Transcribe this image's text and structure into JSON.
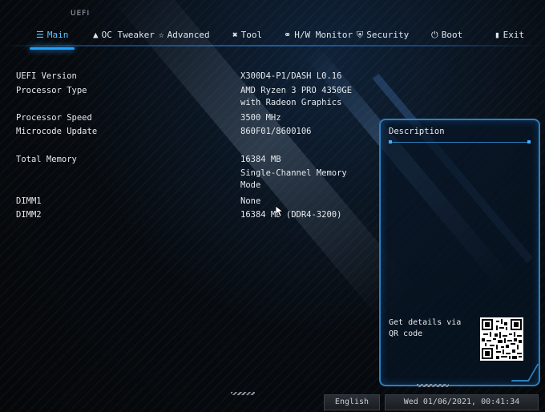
{
  "brand": "UEFI",
  "tabs": [
    {
      "label": "Main",
      "icon": "list-icon",
      "active": true
    },
    {
      "label": "OC Tweaker",
      "icon": "rocket-icon",
      "active": false
    },
    {
      "label": "Advanced",
      "icon": "star-icon",
      "active": false
    },
    {
      "label": "Tool",
      "icon": "tools-icon",
      "active": false
    },
    {
      "label": "H/W Monitor",
      "icon": "monitor-icon",
      "active": false
    },
    {
      "label": "Security",
      "icon": "shield-icon",
      "active": false
    },
    {
      "label": "Boot",
      "icon": "power-icon",
      "active": false
    },
    {
      "label": "Exit",
      "icon": "exit-door-icon",
      "active": false
    }
  ],
  "info": {
    "uefi_version": {
      "label": "UEFI Version",
      "value": "X300D4-P1/DASH L0.16"
    },
    "processor_type": {
      "label": "Processor Type",
      "value_line1": "AMD Ryzen 3 PRO 4350GE",
      "value_line2": "with Radeon Graphics"
    },
    "processor_speed": {
      "label": "Processor Speed",
      "value": "3500 MHz"
    },
    "microcode_update": {
      "label": "Microcode Update",
      "value": "860F01/8600106"
    },
    "total_memory": {
      "label": "Total Memory",
      "value_line1": "16384 MB",
      "value_line2": "Single-Channel Memory",
      "value_line3": "Mode"
    },
    "dimm1": {
      "label": "DIMM1",
      "value": "None"
    },
    "dimm2": {
      "label": "DIMM2",
      "value": "16384 MB (DDR4-3200)"
    }
  },
  "description": {
    "title": "Description",
    "qr_text": "Get details via QR code"
  },
  "footer": {
    "language": "English",
    "datetime": "Wed 01/06/2021, 00:41:34"
  },
  "colors": {
    "accent": "#1fa0ff",
    "panel_border": "#2c7fbf",
    "text": "#e6eaee"
  }
}
